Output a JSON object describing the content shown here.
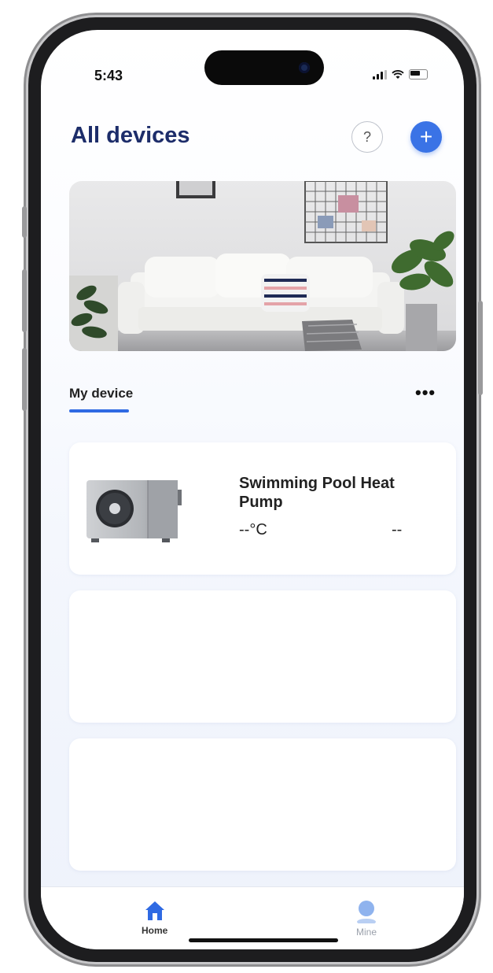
{
  "status_bar": {
    "time": "5:43"
  },
  "header": {
    "title": "All devices",
    "help_icon": "question-circle-icon",
    "help_label": "?",
    "add_icon": "plus-icon",
    "add_label": "+"
  },
  "banner": {
    "image": "living-room-photo"
  },
  "section": {
    "label": "My device",
    "more_label": "•••"
  },
  "devices": [
    {
      "name": "Swimming Pool Heat Pump",
      "temperature": "--°C",
      "state": "--",
      "icon": "heat-pump-unit-icon"
    }
  ],
  "tabbar": {
    "items": [
      {
        "label": "Home",
        "icon": "home-icon",
        "active": true
      },
      {
        "label": "Mine",
        "icon": "user-icon",
        "active": false
      }
    ]
  },
  "colors": {
    "accent": "#3a73e6",
    "title": "#1d2d6a",
    "underline": "#2f6ae3"
  }
}
